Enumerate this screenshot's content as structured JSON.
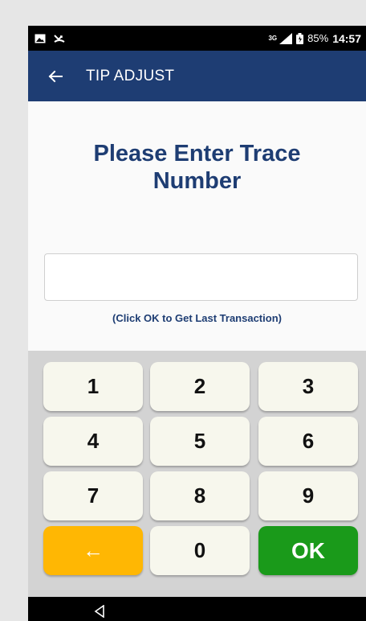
{
  "status_bar": {
    "network_label": "3G",
    "battery_percent": "85%",
    "time": "14:57",
    "icons": [
      "image-notification-icon",
      "missed-call-icon",
      "signal-icon",
      "battery-icon"
    ]
  },
  "app_bar": {
    "title": "TIP ADJUST",
    "back_icon": "arrow-left-icon"
  },
  "main": {
    "heading": "Please Enter Trace Number",
    "input": {
      "value": "",
      "placeholder": ""
    },
    "hint": "(Click OK to Get Last Transaction)"
  },
  "keypad": {
    "keys": [
      "1",
      "2",
      "3",
      "4",
      "5",
      "6",
      "7",
      "8",
      "9",
      "←",
      "0",
      "OK"
    ],
    "colors": {
      "backspace": "#ffb703",
      "ok": "#1a9a1a",
      "key": "#f7f7ed"
    }
  },
  "nav_bar": {
    "back_icon": "triangle-back-icon"
  },
  "colors": {
    "primary": "#1e3d73",
    "keypad_bg": "#d3d3d3"
  }
}
